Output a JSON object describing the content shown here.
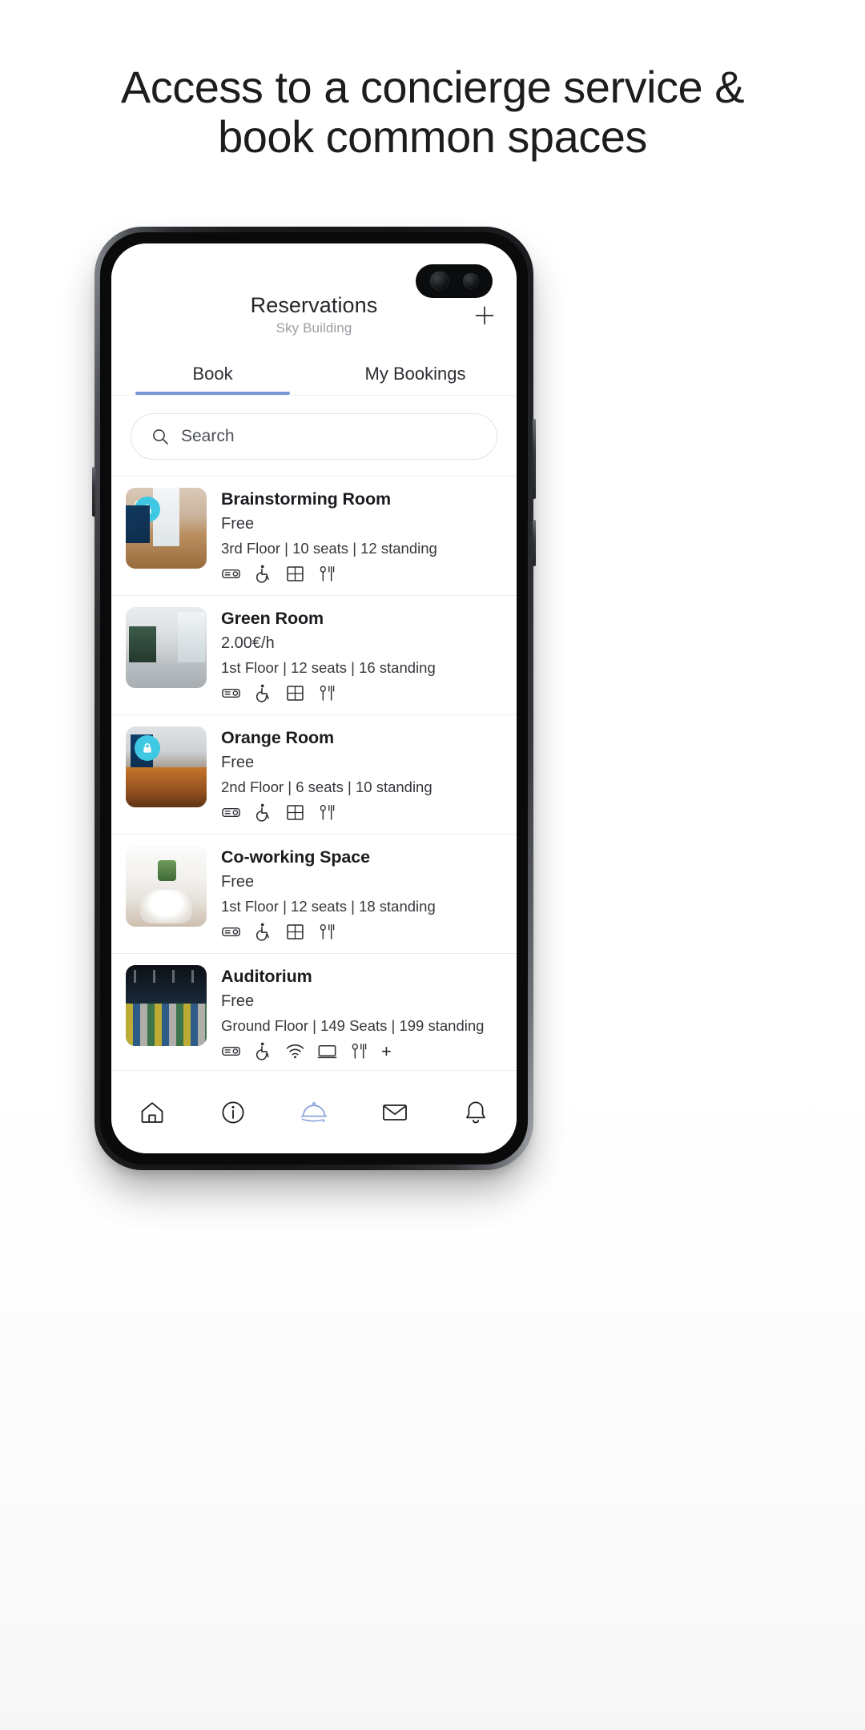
{
  "headline": {
    "line1": "Access to a concierge service &",
    "line2": "book common spaces"
  },
  "app": {
    "title": "Reservations",
    "subtitle": "Sky Building",
    "add_button_icon": "plus-icon",
    "tabs": [
      {
        "label": "Book",
        "active": true
      },
      {
        "label": "My Bookings",
        "active": false
      }
    ],
    "accent_color": "#7b97d4",
    "badge_color": "#3fc8e4"
  },
  "search": {
    "placeholder": "Search",
    "value": "",
    "icon": "search-icon"
  },
  "rooms": [
    {
      "name": "Brainstorming Room",
      "price": "Free",
      "meta": "3rd Floor | 10 seats | 12 standing",
      "locked": true,
      "amenities": [
        "projector-icon",
        "wheelchair-icon",
        "window-icon",
        "cutlery-icon"
      ],
      "more": ""
    },
    {
      "name": "Green Room",
      "price": "2.00€/h",
      "meta": "1st Floor | 12 seats | 16 standing",
      "locked": false,
      "amenities": [
        "projector-icon",
        "wheelchair-icon",
        "window-icon",
        "cutlery-icon"
      ],
      "more": ""
    },
    {
      "name": "Orange Room",
      "price": "Free",
      "meta": "2nd Floor | 6 seats | 10 standing",
      "locked": true,
      "amenities": [
        "projector-icon",
        "wheelchair-icon",
        "window-icon",
        "cutlery-icon"
      ],
      "more": ""
    },
    {
      "name": "Co-working Space",
      "price": "Free",
      "meta": "1st Floor | 12 seats | 18 standing",
      "locked": false,
      "amenities": [
        "projector-icon",
        "wheelchair-icon",
        "window-icon",
        "cutlery-icon"
      ],
      "more": ""
    },
    {
      "name": "Auditorium",
      "price": "Free",
      "meta": "Ground Floor | 149 Seats | 199 standing",
      "locked": false,
      "amenities": [
        "projector-icon",
        "wheelchair-icon",
        "wifi-icon",
        "screen-icon",
        "cutlery-icon"
      ],
      "more": "+"
    }
  ],
  "bottom_nav": [
    {
      "icon": "home-icon",
      "active": false
    },
    {
      "icon": "info-icon",
      "active": false
    },
    {
      "icon": "concierge-bell-icon",
      "active": true
    },
    {
      "icon": "envelope-icon",
      "active": false
    },
    {
      "icon": "notification-bell-icon",
      "active": false
    }
  ]
}
